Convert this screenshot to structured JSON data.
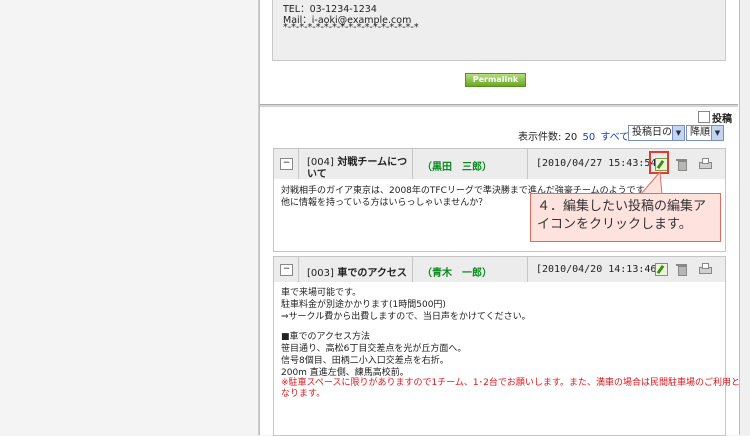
{
  "contact": {
    "tel": "TEL：03-1234-1234",
    "mail": "Mail：i-aoki@example.com",
    "divider": "*-*-*-*-*-*-*-*-*-*-*-*-*-*-*-*-*"
  },
  "permalink_label": "Permalink",
  "toolbar": {
    "post_label": "投稿",
    "display_count_label": "表示件数:",
    "count_20": "20",
    "count_50": "50",
    "count_all": "すべて",
    "sort_select": "投稿日の",
    "order_select": "降順"
  },
  "posts": [
    {
      "toggle": "−",
      "number": "[004]",
      "title_line1": "対戦チームにつ",
      "title_line2": "いて",
      "author": "（黒田　三郎）",
      "date": "[2010/04/27 15:43:54]",
      "body": [
        "対戦相手のガイア東京は、2008年のTFCリーグで準決勝まで進んだ強豪チームのようです。",
        "他に情報を持っている方はいらっしゃいませんか？"
      ]
    },
    {
      "toggle": "−",
      "number": "[003]",
      "title_line1": "車でのアクセス",
      "author": "（青木　一郎）",
      "date": "[2010/04/20 14:13:46]",
      "body": [
        "車で来場可能です。",
        "駐車料金が別途かかります(1時間500円)",
        "⇒サークル費から出費しますので、当日声をかけてください。",
        "",
        "■車でのアクセス方法",
        "笹目通り、高松6丁目交差点を光が丘方面へ。",
        "信号8個目、田柄二小入口交差点を右折。",
        "200m 直進左側、練馬高校前。"
      ],
      "notice": [
        "※駐車スペースに限りがありますので1チーム、1･2台でお願いします。また、満車の場合は民間駐車場のご利用と",
        "なります。"
      ]
    }
  ],
  "callout": "４．編集したい投稿の編集アイコンをクリックします。",
  "colors": {
    "highlight": "#e03b2d",
    "callout_bg": "#fde2de",
    "author_green": "#0b8a1f",
    "notice_red": "#e0151b",
    "link_blue": "#1a3fcf"
  }
}
